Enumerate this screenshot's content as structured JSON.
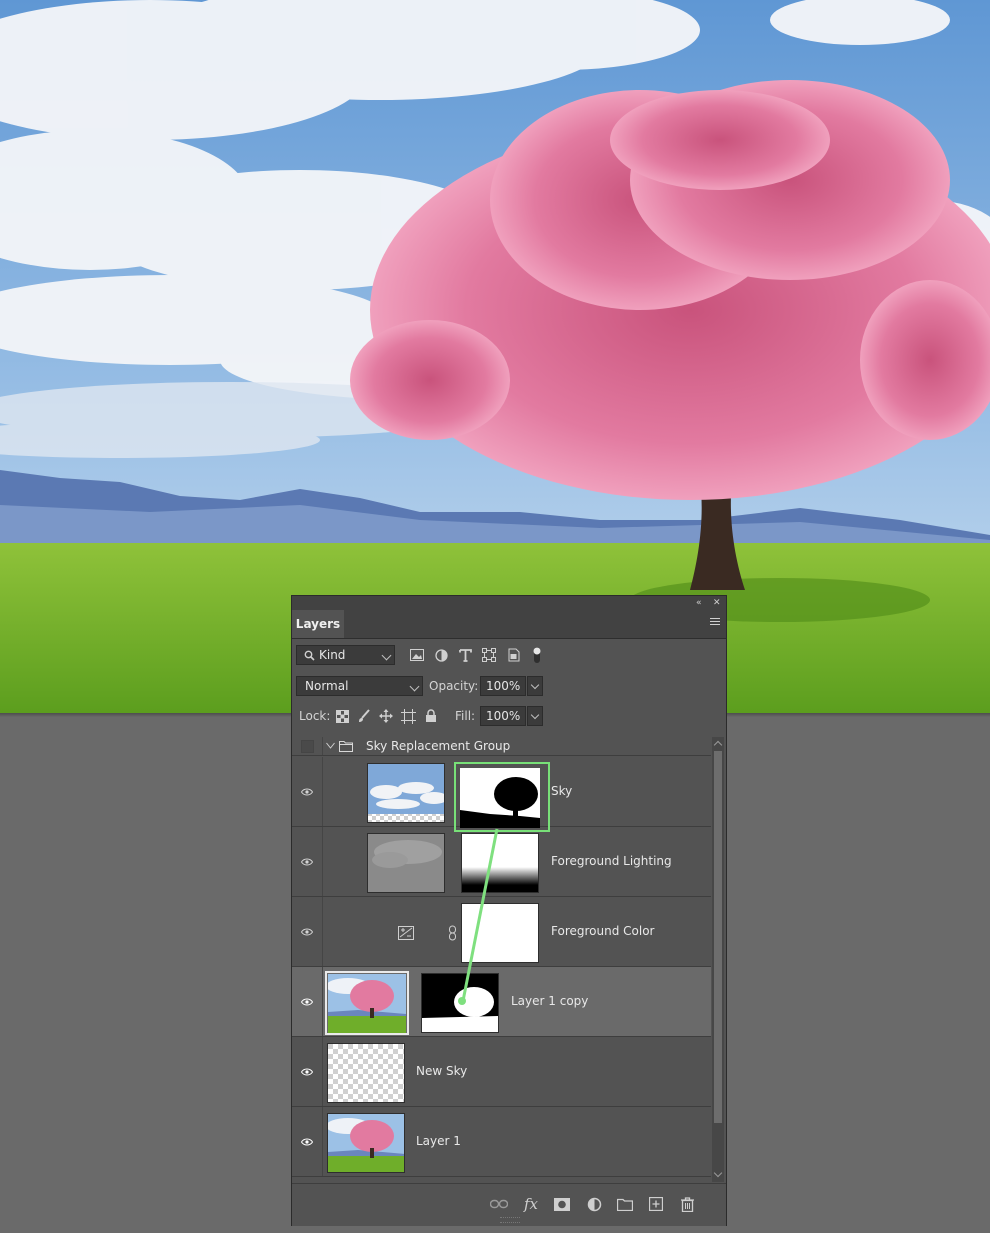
{
  "panel": {
    "tab_label": "Layers",
    "collapse_label": "«",
    "close_label": "✕"
  },
  "filter": {
    "kind_label": "Kind",
    "icons": [
      "image-filter-icon",
      "adjustment-filter-icon",
      "type-filter-icon",
      "shape-filter-icon",
      "smart-object-filter-icon",
      "filter-toggle-icon"
    ]
  },
  "blend": {
    "mode": "Normal",
    "opacity_label": "Opacity:",
    "opacity_value": "100%"
  },
  "lock": {
    "lock_label": "Lock:",
    "fill_label": "Fill:",
    "fill_value": "100%",
    "icons": [
      "lock-transparent-icon",
      "lock-image-icon",
      "lock-position-icon",
      "lock-artboard-icon",
      "lock-all-icon"
    ]
  },
  "layers": [
    {
      "name": "Sky Replacement Group",
      "type": "group",
      "visible": false,
      "expanded": true
    },
    {
      "name": "Sky",
      "type": "layer-with-mask",
      "visible": true,
      "mask_selected": true
    },
    {
      "name": "Foreground Lighting",
      "type": "layer-with-mask",
      "visible": true
    },
    {
      "name": "Foreground Color",
      "type": "adjustment",
      "visible": true
    },
    {
      "name": "Layer 1 copy",
      "type": "layer-with-mask",
      "visible": true,
      "selected": true
    },
    {
      "name": "New Sky",
      "type": "layer",
      "visible": true
    },
    {
      "name": "Layer 1",
      "type": "layer",
      "visible": true
    }
  ],
  "footer": {
    "icons": [
      "link-layers-icon",
      "fx-icon",
      "add-mask-icon",
      "new-adjustment-icon",
      "new-group-icon",
      "new-layer-icon",
      "trash-icon"
    ],
    "fx_label": "fx"
  },
  "colors": {
    "annotation": "#7fe07f",
    "panel_bg": "#535353",
    "selected_row": "#6a6a6a",
    "sky_blossom": "#e47aa2"
  }
}
